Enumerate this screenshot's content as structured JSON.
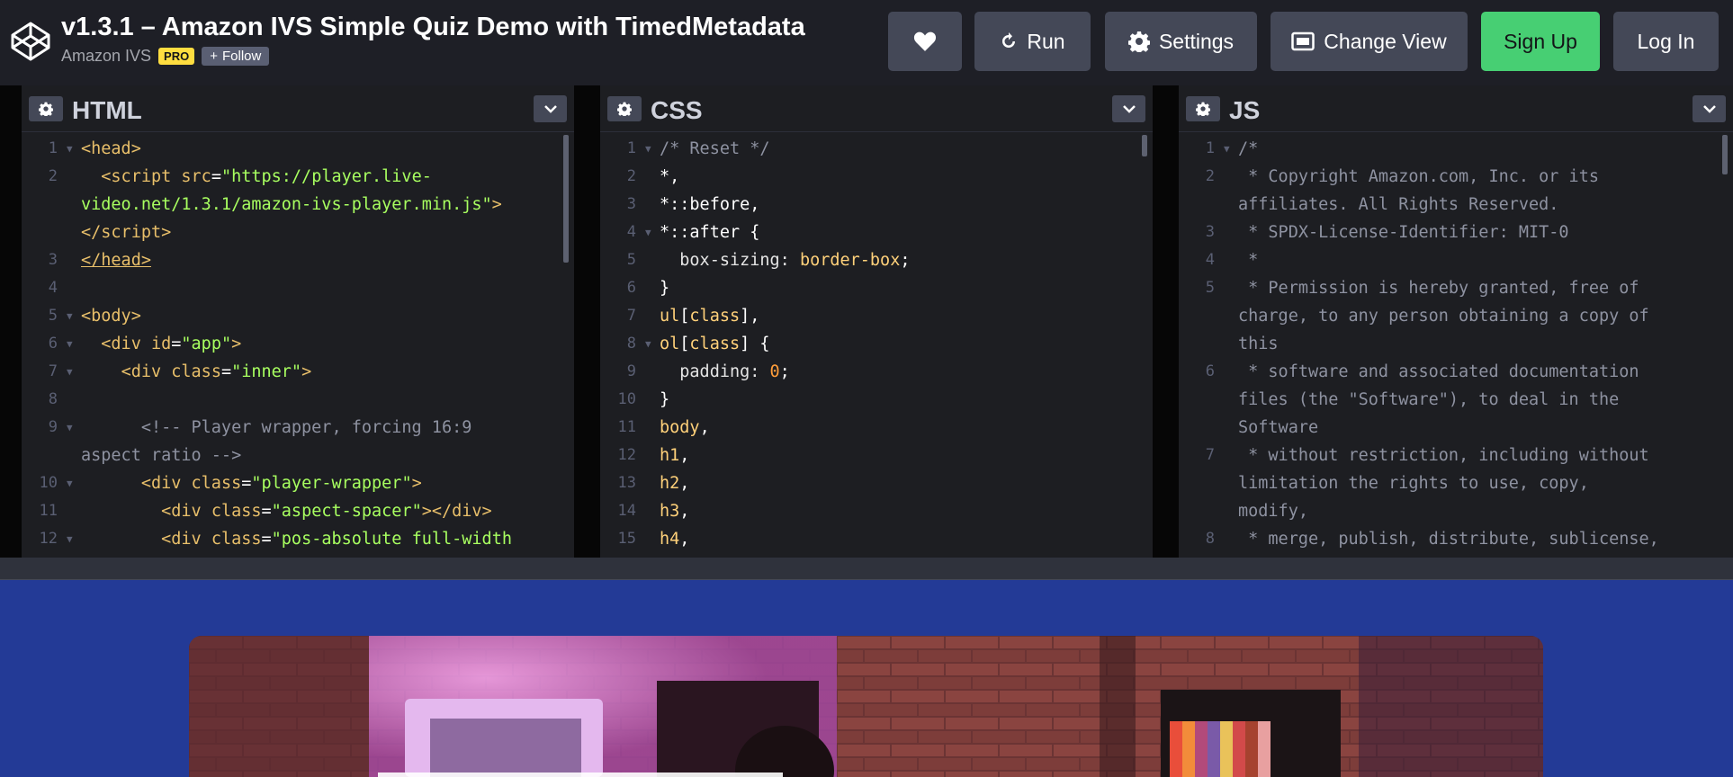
{
  "header": {
    "title": "v1.3.1 – Amazon IVS Simple Quiz Demo with TimedMetadata",
    "owner": "Amazon IVS",
    "badge": "PRO",
    "follow_label": "Follow",
    "buttons": {
      "heart_icon": "heart-icon",
      "run": "Run",
      "settings": "Settings",
      "change_view": "Change View",
      "sign_up": "Sign Up",
      "log_in": "Log In"
    },
    "colors": {
      "signup": "#47cf73",
      "badge": "#ffdd40",
      "header_bg": "#1e1f26"
    }
  },
  "panes": {
    "html": {
      "title": "HTML"
    },
    "css": {
      "title": "CSS"
    },
    "js": {
      "title": "JS"
    }
  },
  "preview": {
    "background": "#233a96"
  }
}
